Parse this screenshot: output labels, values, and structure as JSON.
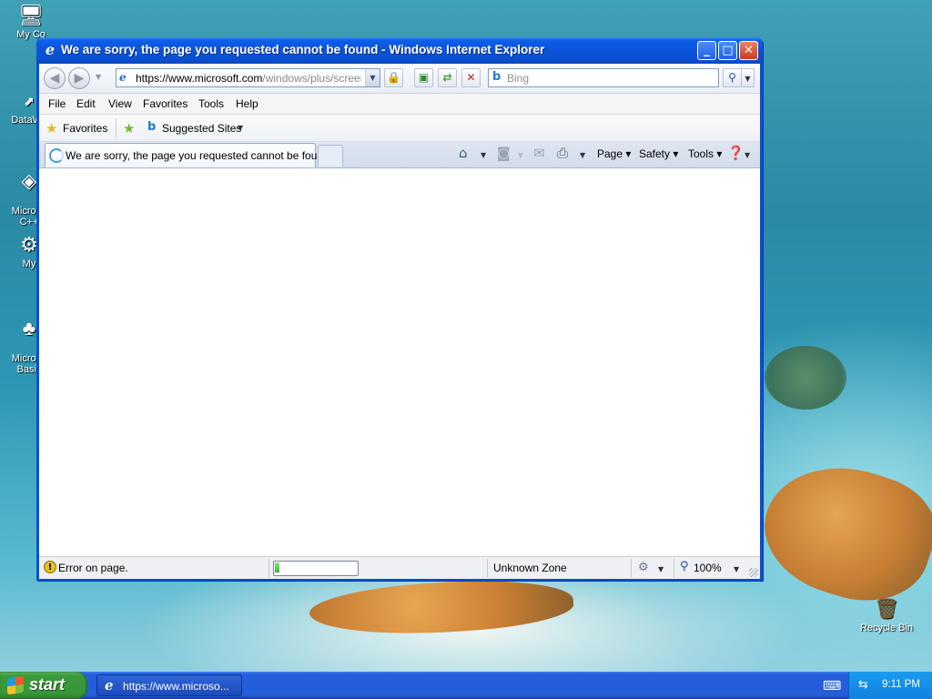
{
  "desktop": {
    "icons": [
      {
        "label": "My Co",
        "icon": "computer-icon"
      },
      {
        "label": "DataWa",
        "icon": "shortcut-icon"
      },
      {
        "label": "Microso\nC++",
        "icon": "visual-cpp-icon"
      },
      {
        "label": "My",
        "icon": "documents-icon"
      },
      {
        "label": "Microso\nBasic",
        "icon": "visual-basic-icon"
      },
      {
        "label": "Recycle Bin",
        "icon": "recycle-bin-icon"
      }
    ]
  },
  "window": {
    "title": "We are sorry, the page you requested cannot be found - Windows Internet Explorer",
    "address": {
      "scheme": "https://",
      "host": "www.microsoft.com",
      "rest": "/windows/plus/screensa"
    },
    "search_placeholder": "Bing",
    "menu": [
      "File",
      "Edit",
      "View",
      "Favorites",
      "Tools",
      "Help"
    ],
    "favorites_bar": {
      "favorites_label": "Favorites",
      "suggested_sites_label": "Suggested Sites"
    },
    "tab": {
      "label": "We are sorry, the page you requested cannot be found"
    },
    "command_bar": {
      "page": "Page",
      "safety": "Safety",
      "tools": "Tools"
    },
    "status": {
      "text": "Error on page.",
      "zone": "Unknown Zone",
      "zoom": "100%",
      "progress_fraction": 0.06
    }
  },
  "taskbar": {
    "start_label": "start",
    "task_label": "https://www.microso...",
    "clock": "9:11 PM"
  },
  "colors": {
    "titlebar": "#0a54d9",
    "taskbar": "#245edb",
    "start": "#3c9a3c",
    "tray": "#0f82e0"
  }
}
